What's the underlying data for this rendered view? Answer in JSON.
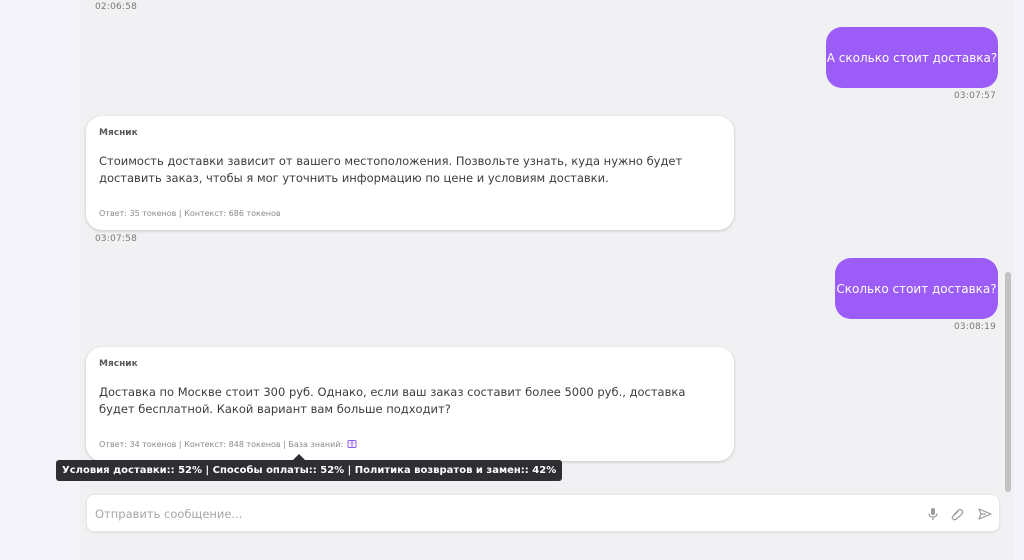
{
  "messages": {
    "prev": {
      "time": "02:06:58"
    },
    "user1": {
      "text": "А сколько стоит доставка?",
      "time": "03:07:57"
    },
    "bot1": {
      "name": "Мясник",
      "text": "Стоимость доставки зависит от вашего местоположения. Позвольте узнать, куда нужно будет доставить заказ, чтобы я мог уточнить информацию по цене и условиям доставки.",
      "meta": "Ответ: 35 токенов | Контекст: 686 токенов",
      "time": "03:07:58"
    },
    "user2": {
      "text": "Сколько стоит доставка?",
      "time": "03:08:19"
    },
    "bot2": {
      "name": "Мясник",
      "text": "Доставка по Москве стоит 300 руб. Однако, если ваш заказ составит более 5000 руб., доставка будет бесплатной. Какой вариант вам больше подходит?",
      "meta": "Ответ: 34 токенов | Контекст: 848 токенов | База знаний:",
      "kb_icon": "knowledge-base-icon"
    }
  },
  "tooltip": {
    "text": "Условия доставки:: 52% | Способы оплаты:: 52% | Политика возвратов и замен:: 42%"
  },
  "composer": {
    "placeholder": "Отправить сообщение...",
    "icons": [
      "microphone-icon",
      "paperclip-icon",
      "send-icon"
    ]
  },
  "colors": {
    "user_bubble": "#9b5cf8",
    "panel_bg": "#f1f0f2",
    "tooltip_bg": "#2f2f33"
  }
}
